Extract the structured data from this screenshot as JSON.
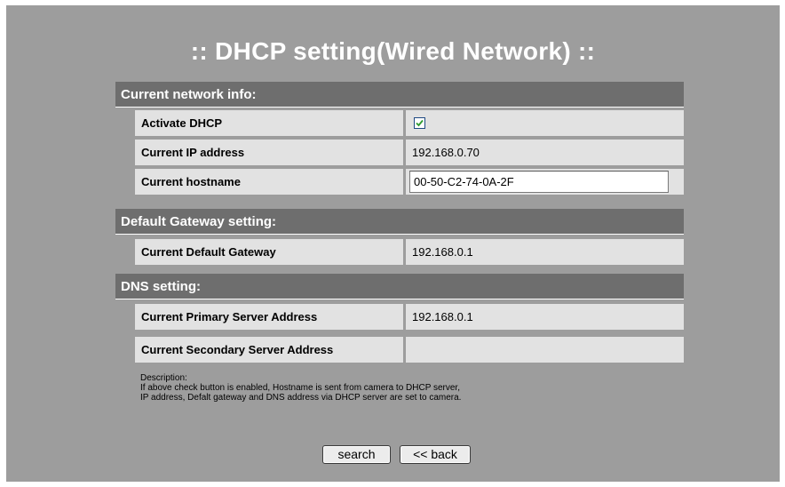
{
  "page": {
    "title": ":: DHCP setting(Wired Network) ::"
  },
  "sections": {
    "network_info": {
      "header": "Current network info:",
      "activate_dhcp_label": "Activate DHCP",
      "activate_dhcp_checked": true,
      "ip_label": "Current IP address",
      "ip_value": "192.168.0.70",
      "hostname_label": "Current hostname",
      "hostname_value": "00-50-C2-74-0A-2F"
    },
    "gateway": {
      "header": "Default Gateway setting:",
      "label": "Current Default Gateway",
      "value": "192.168.0.1"
    },
    "dns": {
      "header": "DNS setting:",
      "primary_label": "Current Primary Server Address",
      "primary_value": "192.168.0.1",
      "secondary_label": "Current Secondary Server Address",
      "secondary_value": ""
    }
  },
  "description": {
    "heading": "Description:",
    "line1": "If above check button is enabled, Hostname is sent from camera to DHCP server,",
    "line2": "IP address, Defalt gateway and DNS address via DHCP server are set to camera."
  },
  "buttons": {
    "search": "search",
    "back": "<< back"
  },
  "colors": {
    "background": "#9d9d9d",
    "section_header": "#6e6e6e",
    "cell": "#e2e2e2",
    "checkmark": "#2e9a2e"
  }
}
